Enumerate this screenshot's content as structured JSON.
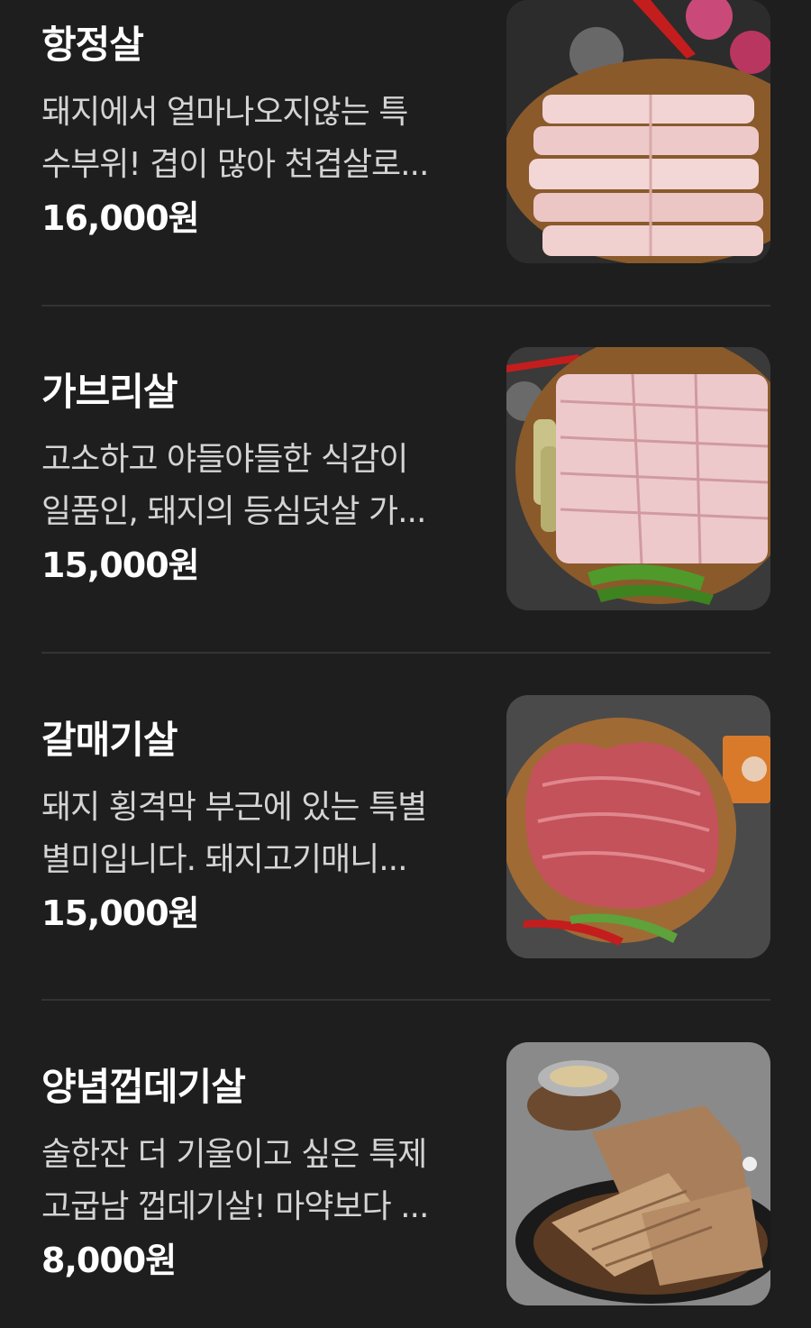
{
  "currency_suffix": "원",
  "items": [
    {
      "name": "항정살",
      "desc_line1": "돼지에서 얼마나오지않는 특",
      "desc_line2": "수부위! 겹이 많아 천겹살로...",
      "price": "16,000원",
      "photo": "sliced-pork-jowl-on-wooden-board"
    },
    {
      "name": "가브리살",
      "desc_line1": "고소하고 야들야들한 식감이",
      "desc_line2": "일품인, 돼지의 등심덧살 가...",
      "price": "15,000원",
      "photo": "sliced-pork-neck-on-wooden-board"
    },
    {
      "name": "갈매기살",
      "desc_line1": "돼지 횡격막 부근에 있는 특별",
      "desc_line2": "별미입니다. 돼지고기매니...",
      "price": "15,000원",
      "photo": "pork-skirt-meat-on-wooden-board"
    },
    {
      "name": "양념껍데기살",
      "desc_line1": "술한잔 더 기울이고 싶은 특제",
      "desc_line2": "고굽남 껍데기살! 마약보다 ...",
      "price": "8,000원",
      "photo": "seasoned-pork-skin-in-sauce"
    }
  ],
  "colors": {
    "background": "#1e1e1e",
    "text": "#ffffff",
    "desc_text": "#d4d4d4",
    "divider": "#333333"
  }
}
